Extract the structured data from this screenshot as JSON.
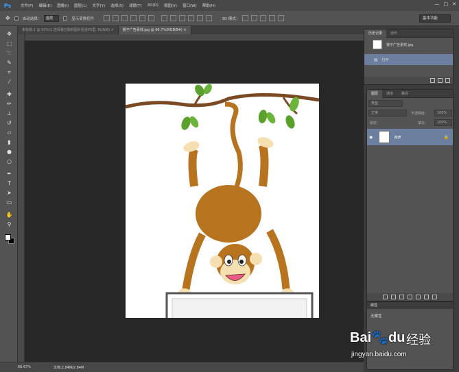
{
  "app": {
    "logo": "Ps",
    "menus": [
      "文件(F)",
      "编辑(E)",
      "图像(I)",
      "图层(L)",
      "文字(Y)",
      "选择(S)",
      "滤镜(T)",
      "3D(D)",
      "视图(V)",
      "窗口(W)",
      "帮助(H)"
    ],
    "window_buttons": [
      "—",
      "□",
      "✕"
    ]
  },
  "options_bar": {
    "auto_select_label": "自动选择：",
    "auto_select_value": "图层",
    "show_transform_label": "显示变换控件",
    "mode_3d_label": "3D 模式：",
    "workspace": "基本功能"
  },
  "tabs": [
    {
      "label": "未标题-1 @ 50%(1.选择我已取的图片贴进PS里, RGB/8) ×",
      "active": false
    },
    {
      "label": "猴子广告素材.jpg @ 66.7%(RGB/8#) ×",
      "active": true
    }
  ],
  "tools": [
    {
      "icon": "move-icon",
      "glyph": "✥"
    },
    {
      "icon": "marquee-icon",
      "glyph": "⬚"
    },
    {
      "icon": "lasso-icon",
      "glyph": "➰"
    },
    {
      "icon": "quick-select-icon",
      "glyph": "✎"
    },
    {
      "icon": "crop-icon",
      "glyph": "⌗"
    },
    {
      "icon": "eyedropper-icon",
      "glyph": "⁄"
    },
    {
      "icon": "healing-icon",
      "glyph": "✚"
    },
    {
      "icon": "brush-icon",
      "glyph": "✏"
    },
    {
      "icon": "stamp-icon",
      "glyph": "⊥"
    },
    {
      "icon": "history-brush-icon",
      "glyph": "↺"
    },
    {
      "icon": "eraser-icon",
      "glyph": "▱"
    },
    {
      "icon": "gradient-icon",
      "glyph": "▮"
    },
    {
      "icon": "blur-icon",
      "glyph": "●"
    },
    {
      "icon": "dodge-icon",
      "glyph": "○"
    },
    {
      "icon": "pen-icon",
      "glyph": "✒"
    },
    {
      "icon": "type-icon",
      "glyph": "T"
    },
    {
      "icon": "path-select-icon",
      "glyph": "➤"
    },
    {
      "icon": "shape-icon",
      "glyph": "▭"
    },
    {
      "icon": "hand-icon",
      "glyph": "✋"
    },
    {
      "icon": "zoom-icon",
      "glyph": "⚲"
    }
  ],
  "history_panel": {
    "tabs": [
      "历史记录",
      "动作"
    ],
    "snapshot": "猴子广告素材.jpg",
    "state": "打开"
  },
  "layers_panel": {
    "tabs": [
      "图层",
      "通道",
      "路径"
    ],
    "kind_filter": "类型",
    "blend_mode": "正常",
    "opacity_label": "不透明度：",
    "opacity_value": "100%",
    "lock_label": "锁定：",
    "fill_label": "填充：",
    "fill_value": "100%",
    "layer_name": "背景",
    "lock_icon": "lock-icon"
  },
  "properties_panel": {
    "tab": "属性",
    "text": "无属性"
  },
  "status": {
    "zoom": "66.67%",
    "doc_size": "文档:2.84M/2.84M"
  },
  "watermark": {
    "logo_a": "Bai",
    "logo_b": "du",
    "cn": "经验",
    "url": "jingyan.baidu.com"
  }
}
